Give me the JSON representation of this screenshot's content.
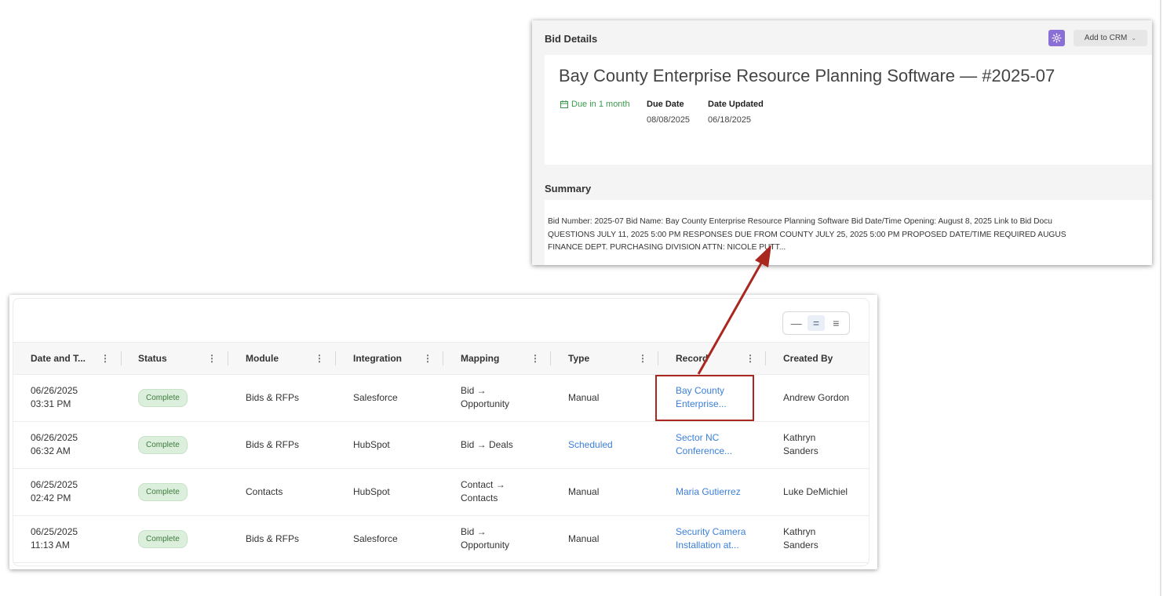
{
  "bid_panel": {
    "header": "Bid Details",
    "add_to_crm_label": "Add to CRM",
    "title": "Bay County Enterprise Resource Planning Software — #2025-07",
    "due_status": "Due in 1 month",
    "due_date_label": "Due Date",
    "due_date_value": "08/08/2025",
    "updated_label": "Date Updated",
    "updated_value": "06/18/2025",
    "summary_header": "Summary",
    "summary_lines": [
      "Bid Number: 2025-07 Bid Name: Bay County Enterprise Resource Planning Software Bid Date/Time Opening: August 8, 2025 Link to Bid Docu",
      "QUESTIONS JULY 11, 2025 5:00 PM RESPONSES DUE FROM COUNTY JULY 25, 2025 5:00 PM PROPOSED DATE/TIME REQUIRED AUGUS",
      "FINANCE DEPT. PURCHASING DIVISION ATTN: NICOLE PUTT..."
    ],
    "colors": {
      "accent_purple": "#8a6fd6",
      "due_green": "#3a9a4c"
    }
  },
  "table": {
    "columns": [
      "Date and T...",
      "Status",
      "Module",
      "Integration",
      "Mapping",
      "Type",
      "Record",
      "Created By"
    ],
    "rows": [
      {
        "date": "06/26/2025",
        "time": "03:31 PM",
        "status": "Complete",
        "module": "Bids & RFPs",
        "integration": "Salesforce",
        "mapping_1": "Bid →",
        "mapping_2": "Opportunity",
        "type": "Manual",
        "record_1": "Bay County",
        "record_2": "Enterprise...",
        "created_1": "Andrew Gordon",
        "created_2": ""
      },
      {
        "date": "06/26/2025",
        "time": "06:32 AM",
        "status": "Complete",
        "module": "Bids & RFPs",
        "integration": "HubSpot",
        "mapping_1": "Bid → Deals",
        "mapping_2": "",
        "type": "Scheduled",
        "record_1": "Sector NC",
        "record_2": "Conference...",
        "created_1": "Kathryn",
        "created_2": "Sanders"
      },
      {
        "date": "06/25/2025",
        "time": "02:42 PM",
        "status": "Complete",
        "module": "Contacts",
        "integration": "HubSpot",
        "mapping_1": "Contact →",
        "mapping_2": "Contacts",
        "type": "Manual",
        "record_1": "Maria Gutierrez",
        "record_2": "",
        "created_1": "Luke DeMichiel",
        "created_2": ""
      },
      {
        "date": "06/25/2025",
        "time": "11:13 AM",
        "status": "Complete",
        "module": "Bids & RFPs",
        "integration": "Salesforce",
        "mapping_1": "Bid →",
        "mapping_2": "Opportunity",
        "type": "Manual",
        "record_1": "Security Camera",
        "record_2": "Installation at...",
        "created_1": "Kathryn",
        "created_2": "Sanders"
      }
    ],
    "density_icons": [
      "density-compact-icon",
      "density-standard-icon",
      "density-comfortable-icon"
    ],
    "colors": {
      "link_blue": "#3b7fd9",
      "badge_green_bg": "#dcefdc",
      "annotation_red": "#a9271e"
    }
  }
}
